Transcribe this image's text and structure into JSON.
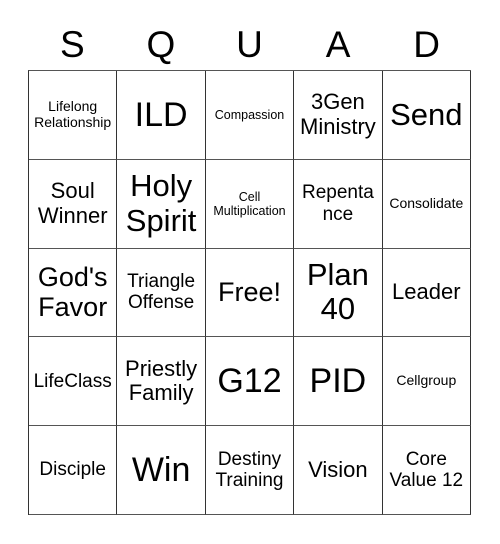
{
  "card": {
    "title_letters": [
      "S",
      "Q",
      "U",
      "A",
      "D"
    ],
    "free_space_label": "Free!",
    "colors": {
      "text": "#000000",
      "background": "#ffffff",
      "grid_line": "#333333"
    },
    "rows": [
      [
        {
          "label": "Lifelong Relationship",
          "size": "xs",
          "free": false
        },
        {
          "label": "ILD",
          "size": "xxl",
          "free": false
        },
        {
          "label": "Compassion",
          "size": "xxs",
          "free": false
        },
        {
          "label": "3Gen Ministry",
          "size": "md",
          "free": false
        },
        {
          "label": "Send",
          "size": "xl",
          "free": false
        }
      ],
      [
        {
          "label": "Soul Winner",
          "size": "md",
          "free": false
        },
        {
          "label": "Holy Spirit",
          "size": "xl",
          "free": false
        },
        {
          "label": "Cell Multiplication",
          "size": "xxs",
          "free": false
        },
        {
          "label": "Repentance",
          "size": "sm",
          "free": false
        },
        {
          "label": "Consolidate",
          "size": "xs",
          "free": false
        }
      ],
      [
        {
          "label": "God's Favor",
          "size": "lg",
          "free": false
        },
        {
          "label": "Triangle Offense",
          "size": "sm",
          "free": false
        },
        {
          "label": "Free!",
          "size": "lg",
          "free": true
        },
        {
          "label": "Plan 40",
          "size": "xl",
          "free": false
        },
        {
          "label": "Leader",
          "size": "md",
          "free": false
        }
      ],
      [
        {
          "label": "LifeClass",
          "size": "sm",
          "free": false
        },
        {
          "label": "Priestly Family",
          "size": "md",
          "free": false
        },
        {
          "label": "G12",
          "size": "xxl",
          "free": false
        },
        {
          "label": "PID",
          "size": "xxl",
          "free": false
        },
        {
          "label": "Cellgroup",
          "size": "xs",
          "free": false
        }
      ],
      [
        {
          "label": "Disciple",
          "size": "sm",
          "free": false
        },
        {
          "label": "Win",
          "size": "xxl",
          "free": false
        },
        {
          "label": "Destiny Training",
          "size": "sm",
          "free": false
        },
        {
          "label": "Vision",
          "size": "md",
          "free": false
        },
        {
          "label": "Core Value 12",
          "size": "sm",
          "free": false
        }
      ]
    ]
  }
}
